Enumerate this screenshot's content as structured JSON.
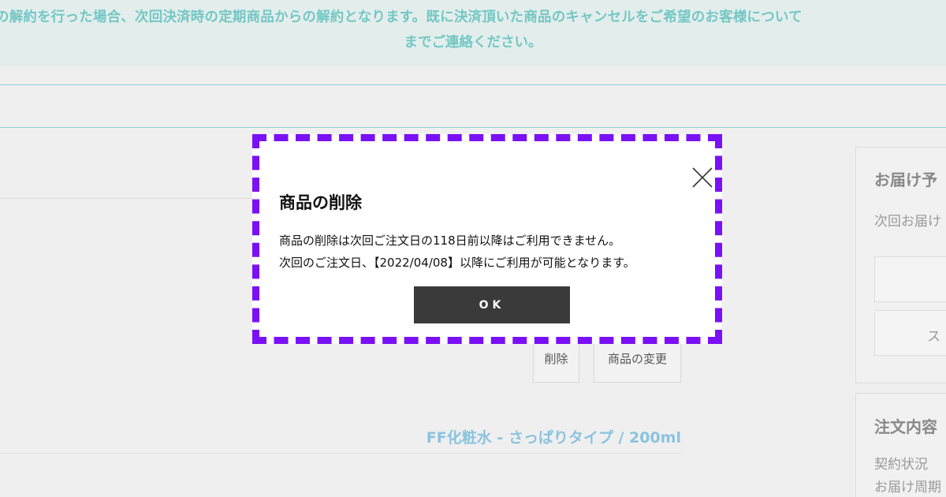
{
  "notice": {
    "line1": "の解約を行った場合、次回決済時の定期商品からの解約となります。既に決済頂いた商品のキャンセルをご希望のお客様について",
    "line2": "までご連絡ください。"
  },
  "item": {
    "delete_label": "削除",
    "change_label": "商品の変更",
    "product_name": "FF化粧水 - さっぱりタイプ / 200ml"
  },
  "sidebar": {
    "box1": {
      "title": "お届け予",
      "text": "次回お届け",
      "field_text": "ス"
    },
    "box2": {
      "title": "注文内容",
      "lines": [
        "契約状況",
        "お届け周期"
      ]
    }
  },
  "modal": {
    "title": "商品の削除",
    "message_line1": "商品の削除は次回ご注文日の118日前以降はご利用できません。",
    "message_line2": "次回のご注文日、【2022/04/08】以降にご利用が可能となります。",
    "ok_label": "OK",
    "close_icon": "close-icon",
    "highlight_color": "#7a10f7"
  }
}
